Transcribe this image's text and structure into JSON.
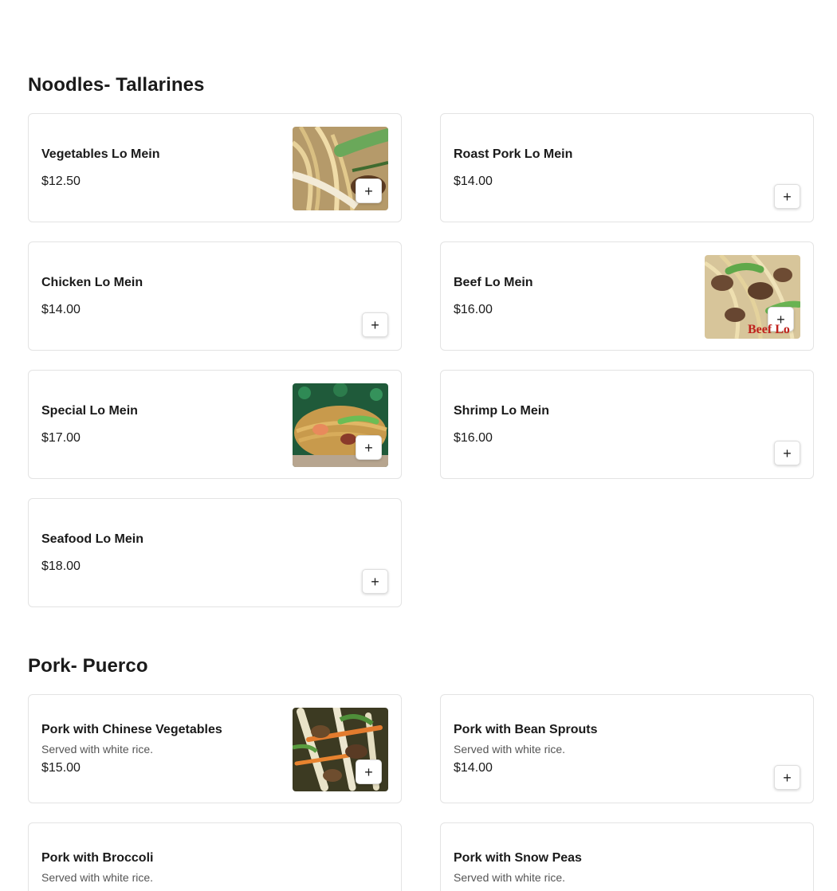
{
  "sections": [
    {
      "title": "Noodles- Tallarines",
      "items": [
        {
          "name": "Vegetables Lo Mein",
          "price": "$12.50",
          "has_image": true
        },
        {
          "name": "Roast Pork Lo Mein",
          "price": "$14.00",
          "has_image": false
        },
        {
          "name": "Chicken Lo Mein",
          "price": "$14.00",
          "has_image": false
        },
        {
          "name": "Beef Lo Mein",
          "price": "$16.00",
          "has_image": true,
          "image_caption": "Beef Lo"
        },
        {
          "name": "Special Lo Mein",
          "price": "$17.00",
          "has_image": true
        },
        {
          "name": "Shrimp Lo Mein",
          "price": "$16.00",
          "has_image": false
        },
        {
          "name": "Seafood Lo Mein",
          "price": "$18.00",
          "has_image": false
        }
      ]
    },
    {
      "title": "Pork- Puerco",
      "items": [
        {
          "name": "Pork with Chinese Vegetables",
          "description": "Served with white rice.",
          "price": "$15.00",
          "has_image": true
        },
        {
          "name": "Pork with Bean Sprouts",
          "description": "Served with white rice.",
          "price": "$14.00",
          "has_image": false
        },
        {
          "name": "Pork with Broccoli",
          "description": "Served with white rice.",
          "has_image": false
        },
        {
          "name": "Pork with Snow Peas",
          "description": "Served with white rice.",
          "has_image": false
        }
      ]
    }
  ],
  "add_button_glyph": "+",
  "icons": {
    "add": "plus-icon"
  }
}
